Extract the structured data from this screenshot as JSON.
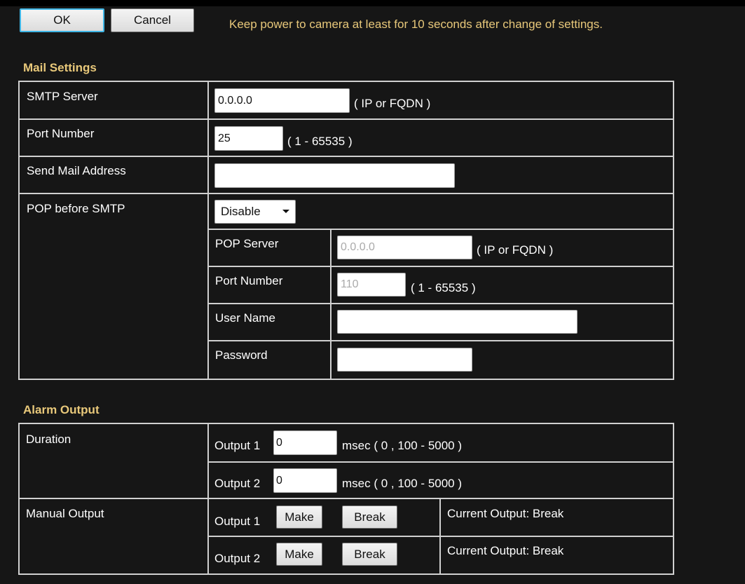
{
  "toolbar": {
    "ok_label": "OK",
    "cancel_label": "Cancel",
    "notice": "Keep power to camera at least for 10 seconds after change of settings."
  },
  "mail": {
    "title": "Mail Settings",
    "smtp_server": {
      "label": "SMTP Server",
      "value": "0.0.0.0",
      "hint": "( IP or FQDN )"
    },
    "port_number": {
      "label": "Port Number",
      "value": "25",
      "hint": "( 1 - 65535 )"
    },
    "send_mail_address": {
      "label": "Send Mail Address",
      "value": ""
    },
    "pop_before_smtp": {
      "label": "POP before SMTP",
      "selected": "Disable",
      "pop_server": {
        "label": "POP Server",
        "value": "0.0.0.0",
        "hint": "( IP or FQDN )"
      },
      "port_number": {
        "label": "Port Number",
        "value": "110",
        "hint": "( 1 - 65535 )"
      },
      "user_name": {
        "label": "User Name",
        "value": ""
      },
      "password": {
        "label": "Password",
        "value": ""
      }
    }
  },
  "alarm": {
    "title": "Alarm Output",
    "duration": {
      "label": "Duration",
      "outputs": [
        {
          "label": "Output 1",
          "value": "0",
          "hint": "msec ( 0 , 100 - 5000 )"
        },
        {
          "label": "Output 2",
          "value": "0",
          "hint": "msec ( 0 , 100 - 5000 )"
        }
      ]
    },
    "manual": {
      "label": "Manual Output",
      "outputs": [
        {
          "label": "Output 1",
          "make": "Make",
          "break": "Break",
          "status": "Current Output: Break"
        },
        {
          "label": "Output 2",
          "make": "Make",
          "break": "Break",
          "status": "Current Output: Break"
        }
      ]
    }
  }
}
